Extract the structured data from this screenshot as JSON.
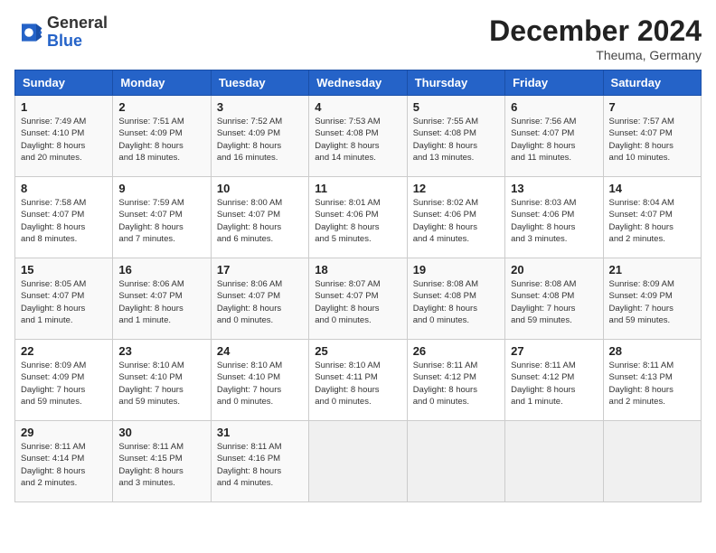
{
  "header": {
    "logo_general": "General",
    "logo_blue": "Blue",
    "month_title": "December 2024",
    "location": "Theuma, Germany"
  },
  "weekdays": [
    "Sunday",
    "Monday",
    "Tuesday",
    "Wednesday",
    "Thursday",
    "Friday",
    "Saturday"
  ],
  "weeks": [
    [
      {
        "day": "1",
        "info": "Sunrise: 7:49 AM\nSunset: 4:10 PM\nDaylight: 8 hours\nand 20 minutes."
      },
      {
        "day": "2",
        "info": "Sunrise: 7:51 AM\nSunset: 4:09 PM\nDaylight: 8 hours\nand 18 minutes."
      },
      {
        "day": "3",
        "info": "Sunrise: 7:52 AM\nSunset: 4:09 PM\nDaylight: 8 hours\nand 16 minutes."
      },
      {
        "day": "4",
        "info": "Sunrise: 7:53 AM\nSunset: 4:08 PM\nDaylight: 8 hours\nand 14 minutes."
      },
      {
        "day": "5",
        "info": "Sunrise: 7:55 AM\nSunset: 4:08 PM\nDaylight: 8 hours\nand 13 minutes."
      },
      {
        "day": "6",
        "info": "Sunrise: 7:56 AM\nSunset: 4:07 PM\nDaylight: 8 hours\nand 11 minutes."
      },
      {
        "day": "7",
        "info": "Sunrise: 7:57 AM\nSunset: 4:07 PM\nDaylight: 8 hours\nand 10 minutes."
      }
    ],
    [
      {
        "day": "8",
        "info": "Sunrise: 7:58 AM\nSunset: 4:07 PM\nDaylight: 8 hours\nand 8 minutes."
      },
      {
        "day": "9",
        "info": "Sunrise: 7:59 AM\nSunset: 4:07 PM\nDaylight: 8 hours\nand 7 minutes."
      },
      {
        "day": "10",
        "info": "Sunrise: 8:00 AM\nSunset: 4:07 PM\nDaylight: 8 hours\nand 6 minutes."
      },
      {
        "day": "11",
        "info": "Sunrise: 8:01 AM\nSunset: 4:06 PM\nDaylight: 8 hours\nand 5 minutes."
      },
      {
        "day": "12",
        "info": "Sunrise: 8:02 AM\nSunset: 4:06 PM\nDaylight: 8 hours\nand 4 minutes."
      },
      {
        "day": "13",
        "info": "Sunrise: 8:03 AM\nSunset: 4:06 PM\nDaylight: 8 hours\nand 3 minutes."
      },
      {
        "day": "14",
        "info": "Sunrise: 8:04 AM\nSunset: 4:07 PM\nDaylight: 8 hours\nand 2 minutes."
      }
    ],
    [
      {
        "day": "15",
        "info": "Sunrise: 8:05 AM\nSunset: 4:07 PM\nDaylight: 8 hours\nand 1 minute."
      },
      {
        "day": "16",
        "info": "Sunrise: 8:06 AM\nSunset: 4:07 PM\nDaylight: 8 hours\nand 1 minute."
      },
      {
        "day": "17",
        "info": "Sunrise: 8:06 AM\nSunset: 4:07 PM\nDaylight: 8 hours\nand 0 minutes."
      },
      {
        "day": "18",
        "info": "Sunrise: 8:07 AM\nSunset: 4:07 PM\nDaylight: 8 hours\nand 0 minutes."
      },
      {
        "day": "19",
        "info": "Sunrise: 8:08 AM\nSunset: 4:08 PM\nDaylight: 8 hours\nand 0 minutes."
      },
      {
        "day": "20",
        "info": "Sunrise: 8:08 AM\nSunset: 4:08 PM\nDaylight: 7 hours\nand 59 minutes."
      },
      {
        "day": "21",
        "info": "Sunrise: 8:09 AM\nSunset: 4:09 PM\nDaylight: 7 hours\nand 59 minutes."
      }
    ],
    [
      {
        "day": "22",
        "info": "Sunrise: 8:09 AM\nSunset: 4:09 PM\nDaylight: 7 hours\nand 59 minutes."
      },
      {
        "day": "23",
        "info": "Sunrise: 8:10 AM\nSunset: 4:10 PM\nDaylight: 7 hours\nand 59 minutes."
      },
      {
        "day": "24",
        "info": "Sunrise: 8:10 AM\nSunset: 4:10 PM\nDaylight: 7 hours\nand 0 minutes."
      },
      {
        "day": "25",
        "info": "Sunrise: 8:10 AM\nSunset: 4:11 PM\nDaylight: 8 hours\nand 0 minutes."
      },
      {
        "day": "26",
        "info": "Sunrise: 8:11 AM\nSunset: 4:12 PM\nDaylight: 8 hours\nand 0 minutes."
      },
      {
        "day": "27",
        "info": "Sunrise: 8:11 AM\nSunset: 4:12 PM\nDaylight: 8 hours\nand 1 minute."
      },
      {
        "day": "28",
        "info": "Sunrise: 8:11 AM\nSunset: 4:13 PM\nDaylight: 8 hours\nand 2 minutes."
      }
    ],
    [
      {
        "day": "29",
        "info": "Sunrise: 8:11 AM\nSunset: 4:14 PM\nDaylight: 8 hours\nand 2 minutes."
      },
      {
        "day": "30",
        "info": "Sunrise: 8:11 AM\nSunset: 4:15 PM\nDaylight: 8 hours\nand 3 minutes."
      },
      {
        "day": "31",
        "info": "Sunrise: 8:11 AM\nSunset: 4:16 PM\nDaylight: 8 hours\nand 4 minutes."
      },
      {
        "day": "",
        "info": ""
      },
      {
        "day": "",
        "info": ""
      },
      {
        "day": "",
        "info": ""
      },
      {
        "day": "",
        "info": ""
      }
    ]
  ]
}
